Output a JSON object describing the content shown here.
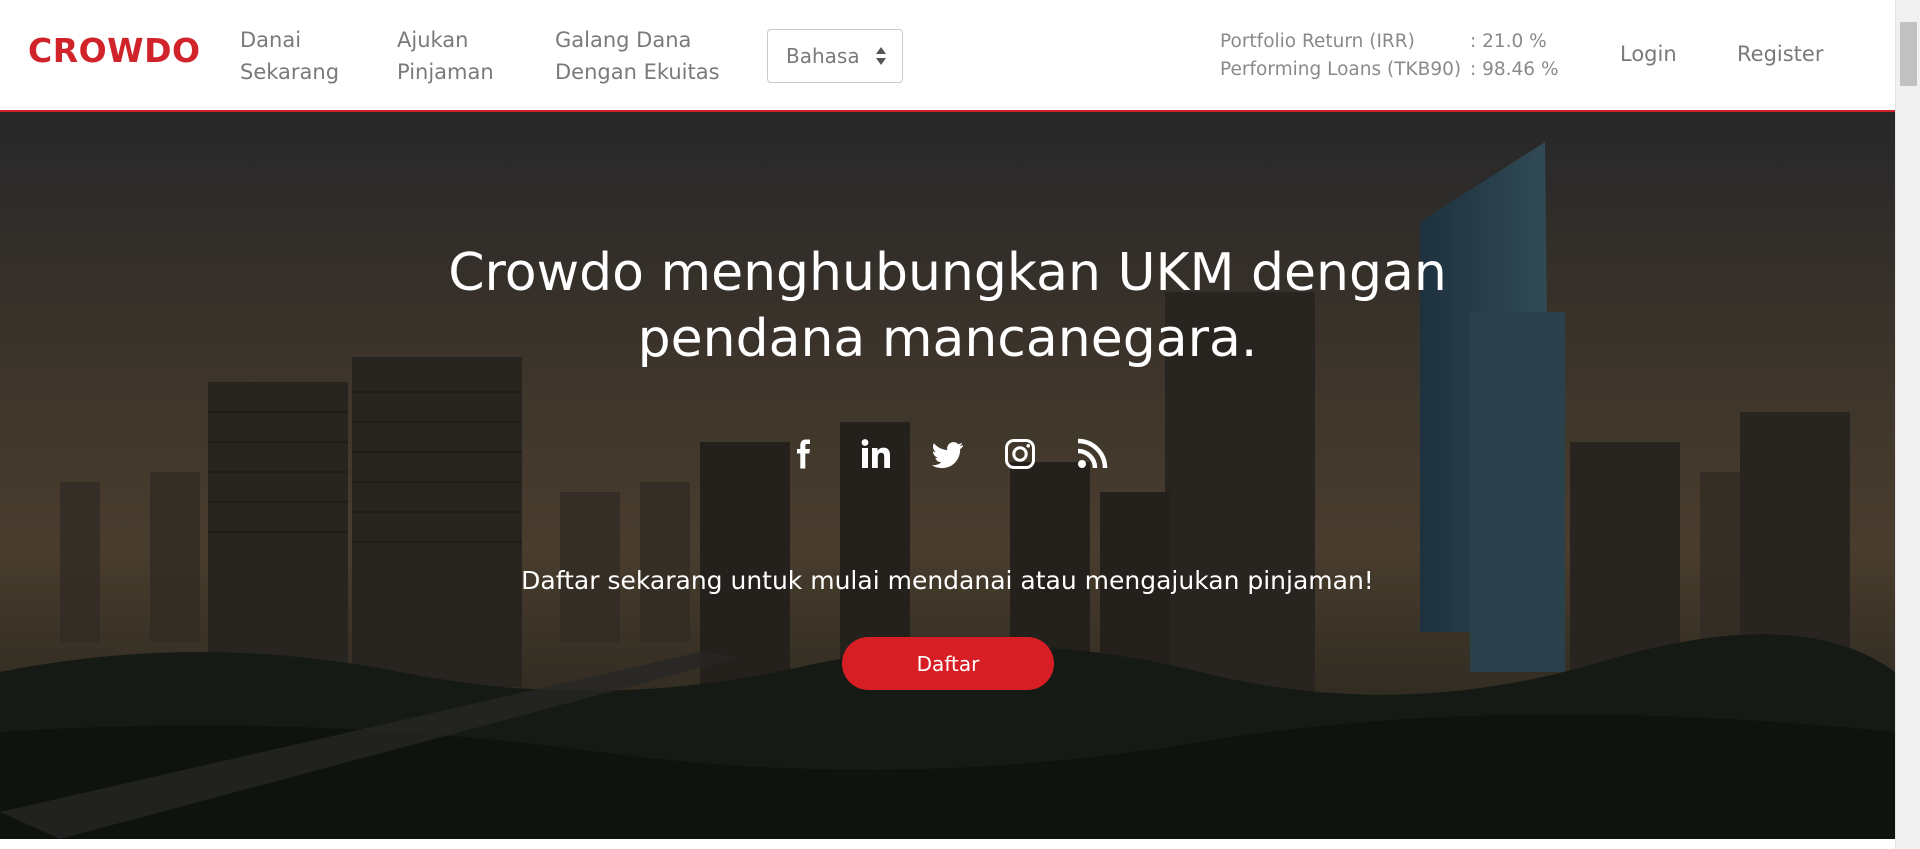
{
  "brand": {
    "logo_text": "CROWDO",
    "accent_color": "#d0232a",
    "button_color": "#d81e25"
  },
  "nav": {
    "items": [
      {
        "line1": "Danai",
        "line2": "Sekarang"
      },
      {
        "line1": "Ajukan",
        "line2": "Pinjaman"
      },
      {
        "line1": "Galang Dana",
        "line2": "Dengan Ekuitas"
      }
    ],
    "language_select": {
      "selected": "Bahasa",
      "icon": "sort-caret-icon"
    }
  },
  "stats": [
    {
      "label": "Portfolio Return (IRR)",
      "value": ": 21.0 %"
    },
    {
      "label": "Performing Loans (TKB90)",
      "value": ": 98.46 %"
    }
  ],
  "auth": {
    "login_label": "Login",
    "register_label": "Register"
  },
  "hero": {
    "title_line1": "Crowdo menghubungkan UKM dengan",
    "title_line2": "pendana mancanegara.",
    "social_icons": [
      "facebook-icon",
      "linkedin-icon",
      "twitter-icon",
      "instagram-icon",
      "rss-icon"
    ],
    "subtitle": "Daftar sekarang untuk mulai mendanai atau mengajukan pinjaman!",
    "cta_label": "Daftar"
  }
}
